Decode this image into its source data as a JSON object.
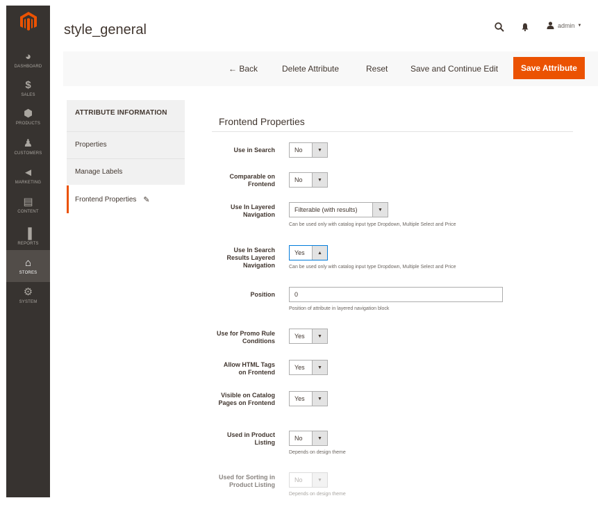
{
  "sidebar": {
    "logo_icon": "magento-logo-icon",
    "items": [
      {
        "label": "DASHBOARD",
        "glyph": "◕"
      },
      {
        "label": "SALES",
        "glyph": "$"
      },
      {
        "label": "PRODUCTS",
        "glyph": "⬢"
      },
      {
        "label": "CUSTOMERS",
        "glyph": "♟"
      },
      {
        "label": "MARKETING",
        "glyph": "◄"
      },
      {
        "label": "CONTENT",
        "glyph": "▤"
      },
      {
        "label": "REPORTS",
        "glyph": "▐"
      },
      {
        "label": "STORES",
        "glyph": "⌂"
      },
      {
        "label": "SYSTEM",
        "glyph": "⚙"
      }
    ],
    "active_item": "STORES"
  },
  "header": {
    "title": "style_general",
    "user": "admin"
  },
  "toolbar": {
    "back_label": "← Back",
    "delete_label": "Delete Attribute",
    "reset_label": "Reset",
    "save_continue_label": "Save and Continue Edit",
    "save_label": "Save Attribute"
  },
  "tabs": {
    "heading": "ATTRIBUTE INFORMATION",
    "items": [
      {
        "label": "Properties"
      },
      {
        "label": "Manage Labels"
      },
      {
        "label": "Frontend Properties"
      }
    ],
    "active": "Frontend Properties"
  },
  "form": {
    "section_title": "Frontend Properties",
    "use_in_search": {
      "label": "Use in Search",
      "value": "No"
    },
    "comparable": {
      "label": "Comparable on Frontend",
      "value": "No"
    },
    "layered_nav": {
      "label": "Use In Layered Navigation",
      "value": "Filterable (with results)",
      "note": "Can be used only with catalog input type Dropdown, Multiple Select and Price"
    },
    "search_layered_nav": {
      "label": "Use In Search Results Layered Navigation",
      "value": "Yes",
      "note": "Can be used only with catalog input type Dropdown, Multiple Select and Price"
    },
    "position": {
      "label": "Position",
      "value": "0",
      "note": "Position of attribute in layered navigation block"
    },
    "promo_rules": {
      "label": "Use for Promo Rule Conditions",
      "value": "Yes"
    },
    "html_tags": {
      "label": "Allow HTML Tags on Frontend",
      "value": "Yes"
    },
    "visible_catalog": {
      "label": "Visible on Catalog Pages on Frontend",
      "value": "Yes"
    },
    "product_listing": {
      "label": "Used in Product Listing",
      "value": "No",
      "note": "Depends on design theme"
    },
    "sorting": {
      "label": "Used for Sorting in Product Listing",
      "value": "No",
      "note": "Depends on design theme"
    }
  },
  "colors": {
    "sidebar_bg": "#373330",
    "accent": "#eb5202",
    "text": "#41362f"
  }
}
